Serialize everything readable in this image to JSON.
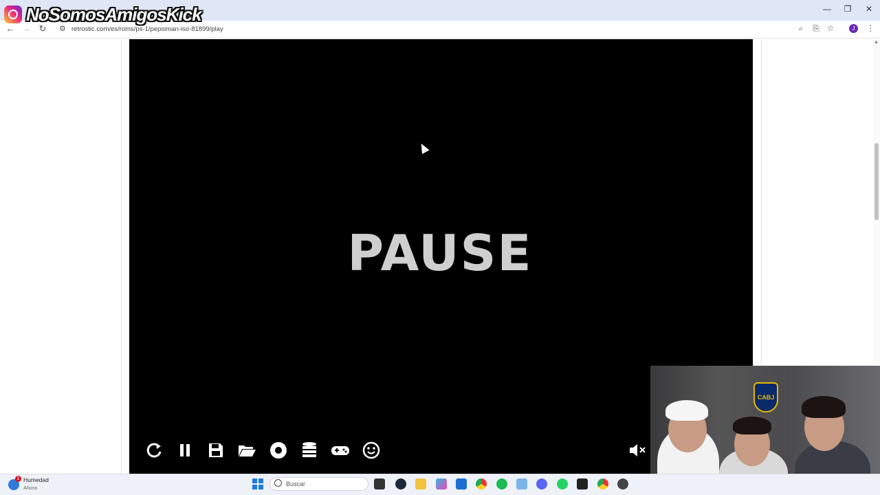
{
  "overlay": {
    "brand": "NoSomosAmigosKick"
  },
  "browser": {
    "url": "retrostic.com/es/roms/ps-1/pepsiman-iso-81899/play",
    "profile_initial": "J",
    "window_controls": {
      "minimize": "—",
      "restore": "❐",
      "close": "✕"
    }
  },
  "game": {
    "pause_text": "PAUSE",
    "controls": [
      "restart-icon",
      "pause-icon",
      "save-icon",
      "load-icon",
      "record-icon",
      "database-icon",
      "gamepad-icon",
      "smiley-icon",
      "mute-icon"
    ]
  },
  "taskbar": {
    "weather_title": "Humedad",
    "weather_sub": "Ahora",
    "weather_badge": "1",
    "search_placeholder": "Buscar"
  },
  "webcam": {
    "crest_text": "CABJ"
  }
}
